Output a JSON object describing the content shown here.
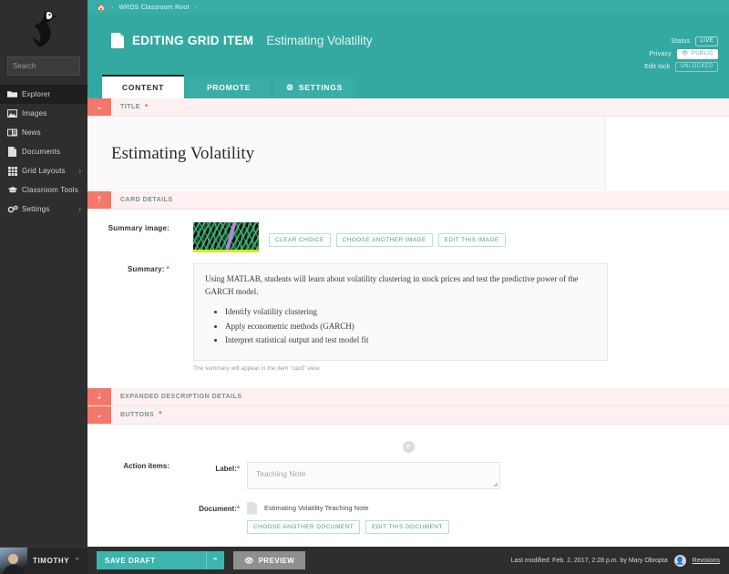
{
  "sidebar": {
    "logo_icon": "bird-logo",
    "search": {
      "placeholder": "Search",
      "value": "",
      "icon": "search-icon"
    },
    "items": [
      {
        "label": "Explorer",
        "icon": "folder-icon",
        "active": true,
        "caret": ""
      },
      {
        "label": "Images",
        "icon": "image-icon",
        "active": false,
        "caret": ""
      },
      {
        "label": "News",
        "icon": "news-icon",
        "active": false,
        "caret": ""
      },
      {
        "label": "Documents",
        "icon": "document-icon",
        "active": false,
        "caret": ""
      },
      {
        "label": "Grid Layouts",
        "icon": "grid-icon",
        "active": false,
        "caret": "›"
      },
      {
        "label": "Classroom Tools",
        "icon": "graduation-cap-icon",
        "active": false,
        "caret": ""
      },
      {
        "label": "Settings",
        "icon": "gears-icon",
        "active": false,
        "caret": "›"
      }
    ],
    "user": {
      "name": "TIMOTHY",
      "caret": "⌃"
    }
  },
  "breadcrumb": {
    "home_icon": "home-icon",
    "sep": "›",
    "root": "WRDS Classroom Root",
    "sep2": "›"
  },
  "header": {
    "doc_icon": "document-icon",
    "title_strong": "EDITING GRID ITEM",
    "title_light": "Estimating Volatility",
    "status": [
      {
        "label": "Status",
        "badge": "LIVE",
        "style": "outline",
        "icon": ""
      },
      {
        "label": "Privacy",
        "badge": "PUBLIC",
        "style": "filled",
        "icon": "eye-icon"
      },
      {
        "label": "Edit lock",
        "badge": "UNLOCKED",
        "style": "dim",
        "icon": ""
      }
    ],
    "accent_teal": "#34a9a1"
  },
  "tabs": [
    {
      "label": "CONTENT",
      "active": true,
      "icon": ""
    },
    {
      "label": "PROMOTE",
      "active": false,
      "icon": ""
    },
    {
      "label": "SETTINGS",
      "active": false,
      "icon": "gear-icon"
    }
  ],
  "sections": {
    "title": {
      "bar_label": "TITLE",
      "required": "*",
      "toggle_icon": "chevron-down-icon",
      "value": "Estimating Volatility"
    },
    "card_details": {
      "bar_label": "CARD DETAILS",
      "required": "",
      "toggle_icon": "chevron-up-icon",
      "summary_image": {
        "label": "Summary image:",
        "buttons": [
          "CLEAR CHOICE",
          "CHOOSE ANOTHER IMAGE",
          "EDIT THIS IMAGE"
        ]
      },
      "summary": {
        "label": "Summary:",
        "required": "*",
        "paragraph": "Using MATLAB, students will learn about volatility clustering in stock prices and test the predictive power of the GARCH model.",
        "bullets": [
          "Identify volatility clustering",
          "Apply econometric methods (GARCH)",
          "Interpret statistical output and test model fit"
        ],
        "help": "The summary will appear in the item \"card\" view."
      }
    },
    "expanded_description": {
      "bar_label": "EXPANDED DESCRIPTION DETAILS",
      "required": "",
      "toggle_icon": "anchor-down-icon"
    },
    "buttons": {
      "bar_label": "BUTTONS",
      "required": "*",
      "toggle_icon": "chevron-down-icon",
      "add_icon": "plus-circle-icon",
      "action_items_label": "Action items:",
      "label_field": {
        "label": "Label:",
        "required": "*",
        "placeholder": "Teaching Note",
        "value": ""
      },
      "document_field": {
        "label": "Document:",
        "required": "*",
        "icon": "file-icon",
        "name": "Estimating Volatility Teaching Note",
        "buttons": [
          "CHOOSE ANOTHER DOCUMENT",
          "EDIT THIS DOCUMENT"
        ]
      }
    }
  },
  "bottom_bar": {
    "save_label": "SAVE DRAFT",
    "save_caret": "⌃",
    "preview_label": "PREVIEW",
    "preview_icon": "eye-icon",
    "last_modified": "Last modified: Feb. 2, 2017, 2:28 p.m. by Mary Obropta",
    "user_icon": "user-icon",
    "revisions_label": "Revisions"
  }
}
